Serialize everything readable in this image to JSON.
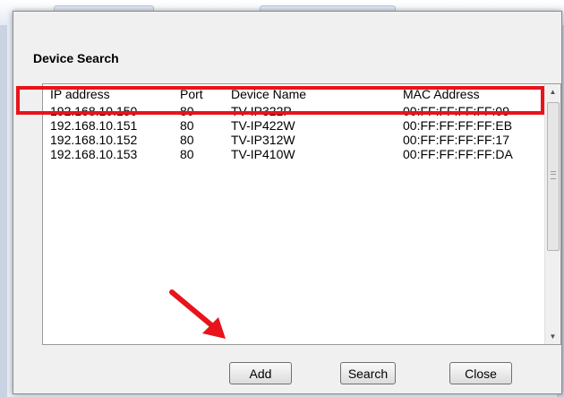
{
  "dialog": {
    "title": "Device Search"
  },
  "table": {
    "columns": [
      "IP address",
      "Port",
      "Device Name",
      "MAC Address"
    ],
    "rows": [
      {
        "ip": "192.168.10.150",
        "port": "80",
        "name": "TV-IP322P",
        "mac": "00:FF:FF:FF:FF:09"
      },
      {
        "ip": "192.168.10.151",
        "port": "80",
        "name": "TV-IP422W",
        "mac": "00:FF:FF:FF:FF:EB"
      },
      {
        "ip": "192.168.10.152",
        "port": "80",
        "name": "TV-IP312W",
        "mac": "00:FF:FF:FF:FF:17"
      },
      {
        "ip": "192.168.10.153",
        "port": "80",
        "name": "TV-IP410W",
        "mac": "00:FF:FF:FF:FF:DA"
      }
    ],
    "highlighted_row": 0
  },
  "buttons": {
    "add": "Add",
    "search": "Search",
    "close": "Close"
  },
  "annotation": {
    "highlight_color": "#e8131b",
    "arrow_color": "#e8131b",
    "arrow_target": "add-button"
  }
}
